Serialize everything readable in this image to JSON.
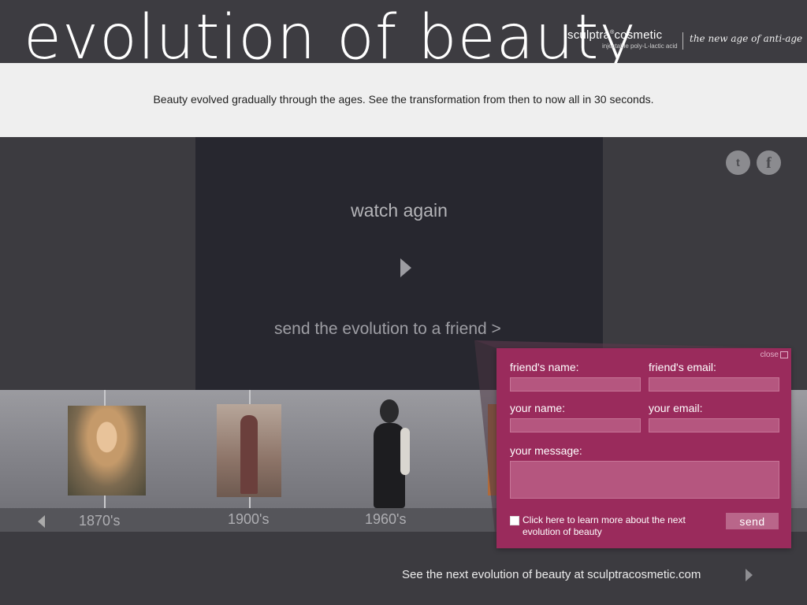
{
  "header": {
    "title": "evolution of beauty",
    "brand_name": "sculptra",
    "brand_name_suffix": "cosmetic",
    "brand_trademark": "®",
    "brand_sub": "injectable poly-L-lactic acid",
    "brand_tagline": "the new age of anti-age"
  },
  "intro": {
    "text": "Beauty evolved gradually through the ages. See the transformation from then to now all in 30 seconds."
  },
  "stage": {
    "watch_again": "watch again",
    "send_to_friend": "send the evolution to a friend  >"
  },
  "social": {
    "twitter_icon": "twitter-icon",
    "twitter_glyph": "t",
    "facebook_icon": "facebook-icon",
    "facebook_glyph": "f"
  },
  "timeline": {
    "eras": [
      {
        "label": "1870's"
      },
      {
        "label": "1900's"
      },
      {
        "label": "1960's"
      }
    ]
  },
  "send_form": {
    "close_label": "close",
    "friend_name_label": "friend's name:",
    "friend_email_label": "friend's email:",
    "your_name_label": "your name:",
    "your_email_label": "your email:",
    "message_label": "your message:",
    "friend_name_value": "",
    "friend_email_value": "",
    "your_name_value": "",
    "your_email_value": "",
    "message_value": "",
    "checkbox_label": "Click here to learn more about the next evolution of beauty",
    "send_label": "send"
  },
  "footer": {
    "link_text": "See the next evolution of beauty at sculptracosmetic.com"
  },
  "colors": {
    "background": "#3c3b40",
    "stage": "#27272f",
    "panel": "#9a2b5c",
    "intro_band": "#efefef"
  }
}
